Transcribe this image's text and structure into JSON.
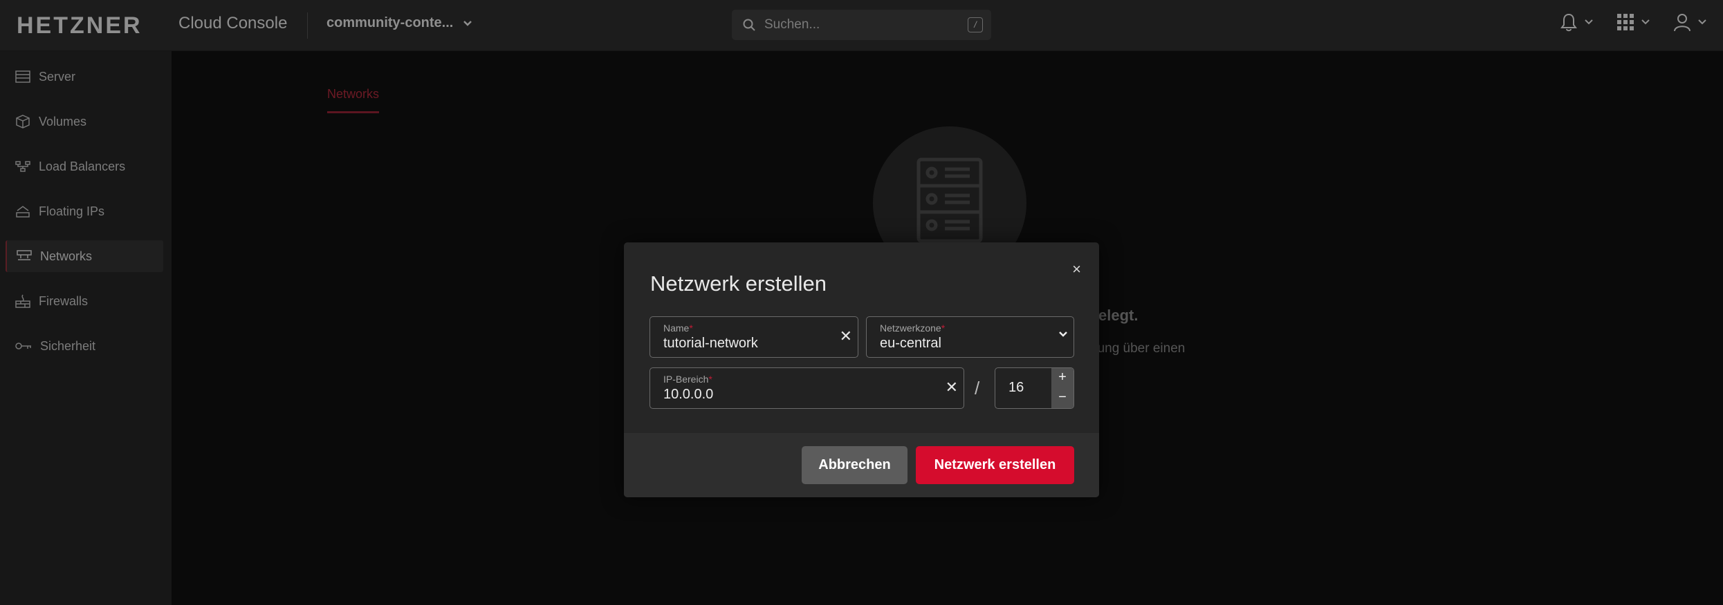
{
  "header": {
    "logo": "HETZNER",
    "product": "Cloud Console",
    "project": "community-conte...",
    "search_placeholder": "Suchen...",
    "search_shortcut": "/"
  },
  "sidebar": {
    "items": [
      {
        "label": "Server",
        "icon": "server-icon"
      },
      {
        "label": "Volumes",
        "icon": "volume-icon"
      },
      {
        "label": "Load Balancers",
        "icon": "load-balancer-icon"
      },
      {
        "label": "Floating IPs",
        "icon": "floating-ip-icon"
      },
      {
        "label": "Networks",
        "icon": "network-icon",
        "active": true
      },
      {
        "label": "Firewalls",
        "icon": "firewall-icon"
      },
      {
        "label": "Sicherheit",
        "icon": "key-icon"
      }
    ]
  },
  "main": {
    "tab": "Networks",
    "empty_heading_fragment": "elegt.",
    "empty_text_fragment": "dung über einen"
  },
  "modal": {
    "title": "Netzwerk erstellen",
    "close_glyph": "×",
    "name_label": "Name",
    "name_value": "tutorial-network",
    "zone_label": "Netzwerkzone",
    "zone_value": "eu-central",
    "ip_label": "IP-Bereich",
    "ip_value": "10.0.0.0",
    "separator": "/",
    "prefix_value": "16",
    "required_mark": "*",
    "cancel_label": "Abbrechen",
    "submit_label": "Netzwerk erstellen"
  },
  "colors": {
    "accent": "#d50c2d",
    "background": "#0b0b0b",
    "sidebar": "#171717",
    "modal": "#262626"
  }
}
